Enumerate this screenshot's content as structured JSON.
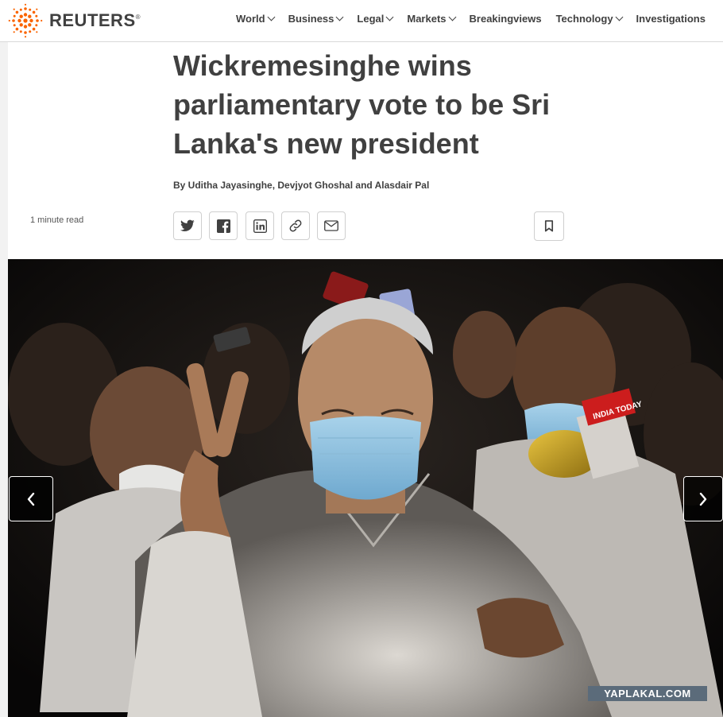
{
  "brand": {
    "name": "REUTERS",
    "registered": "®",
    "accent": "#fa6400"
  },
  "nav": {
    "items": [
      {
        "label": "World",
        "has_dropdown": true
      },
      {
        "label": "Business",
        "has_dropdown": true
      },
      {
        "label": "Legal",
        "has_dropdown": true
      },
      {
        "label": "Markets",
        "has_dropdown": true
      },
      {
        "label": "Breakingviews",
        "has_dropdown": false
      },
      {
        "label": "Technology",
        "has_dropdown": true
      },
      {
        "label": "Investigations",
        "has_dropdown": false
      }
    ]
  },
  "article": {
    "headline": "Wickremesinghe wins parliamentary vote to be Sri Lanka's new president",
    "byline": "By Uditha Jayasinghe, Devjyot Ghoshal and Alasdair Pal",
    "read_time": "1 minute read",
    "share_icons": [
      "twitter-icon",
      "facebook-icon",
      "linkedin-icon",
      "link-icon",
      "email-icon"
    ],
    "bookmark_icon": "bookmark-icon"
  },
  "gallery": {
    "prev_icon": "chevron-left-icon",
    "next_icon": "chevron-right-icon",
    "mic_flag_text": "INDIA TODAY"
  },
  "watermark": "YAPLAKAL.COM"
}
